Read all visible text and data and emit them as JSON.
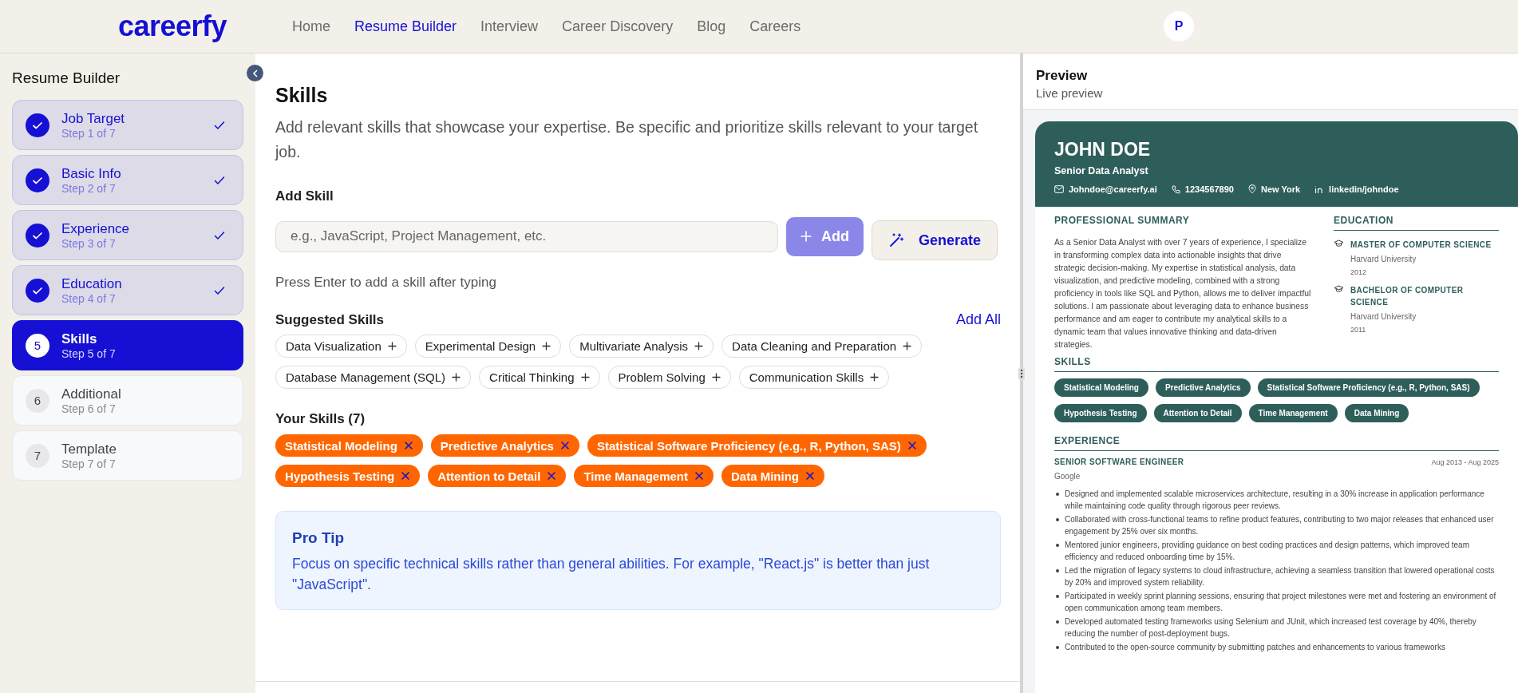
{
  "header": {
    "logo": "careerfy",
    "nav": [
      {
        "label": "Home",
        "selected": false
      },
      {
        "label": "Resume Builder",
        "selected": true
      },
      {
        "label": "Interview",
        "selected": false
      },
      {
        "label": "Career Discovery",
        "selected": false
      },
      {
        "label": "Blog",
        "selected": false
      },
      {
        "label": "Careers",
        "selected": false
      }
    ],
    "avatar": "P"
  },
  "sidebar": {
    "title": "Resume Builder",
    "steps": [
      {
        "label": "Job Target",
        "step": "Step 1 of 7",
        "completed": true,
        "selected": false
      },
      {
        "label": "Basic Info",
        "step": "Step 2 of 7",
        "completed": true,
        "selected": false
      },
      {
        "label": "Experience",
        "step": "Step 3 of 7",
        "completed": true,
        "selected": false
      },
      {
        "label": "Education",
        "step": "Step 4 of 7",
        "completed": true,
        "selected": false
      },
      {
        "number": "5",
        "label": "Skills",
        "step": "Step 5 of 7",
        "completed": false,
        "selected": true
      },
      {
        "number": "6",
        "label": "Additional",
        "step": "Step 6 of 7",
        "completed": false,
        "selected": false
      },
      {
        "number": "7",
        "label": "Template",
        "step": "Step 7 of 7",
        "completed": false,
        "selected": false
      }
    ]
  },
  "editor": {
    "title": "Skills",
    "description": "Add relevant skills that showcase your expertise. Be specific and prioritize skills relevant to your target job.",
    "add_skill": {
      "label": "Add Skill",
      "placeholder": "e.g., JavaScript, Project Management, etc.",
      "add_button": "Add",
      "generate_button": "Generate",
      "hint": "Press Enter to add a skill after typing"
    },
    "suggested": {
      "label": "Suggested Skills",
      "add_all": "Add All",
      "skills": [
        "Data Visualization",
        "Experimental Design",
        "Multivariate Analysis",
        "Data Cleaning and Preparation",
        "Database Management (SQL)",
        "Critical Thinking",
        "Problem Solving",
        "Communication Skills"
      ]
    },
    "your_skills": {
      "label": "Your Skills (7)",
      "skills": [
        "Statistical Modeling",
        "Predictive Analytics",
        "Statistical Software Proficiency (e.g., R, Python, SAS)",
        "Hypothesis Testing",
        "Attention to Detail",
        "Time Management",
        "Data Mining"
      ]
    },
    "tip": {
      "title": "Pro Tip",
      "text": "Focus on specific technical skills rather than general abilities. For example, \"React.js\" is better than just \"JavaScript\"."
    }
  },
  "preview": {
    "title": "Preview",
    "subtitle": "Live preview",
    "resume": {
      "name": "JOHN DOE",
      "role": "Senior Data Analyst",
      "contacts": [
        {
          "kind": "email",
          "text": "Johndoe@careerfy.ai"
        },
        {
          "kind": "phone",
          "text": "1234567890"
        },
        {
          "kind": "location",
          "text": "New York"
        },
        {
          "kind": "linkedin",
          "text": "linkedin/johndoe"
        }
      ],
      "summary_heading": "PROFESSIONAL SUMMARY",
      "summary": "As a Senior Data Analyst with over 7 years of experience, I specialize in transforming complex data into actionable insights that drive strategic decision-making. My expertise in statistical analysis, data visualization, and predictive modeling, combined with a strong proficiency in tools like SQL and Python, allows me to deliver impactful solutions. I am passionate about leveraging data to enhance business performance and am eager to contribute my analytical skills to a dynamic team that values innovative thinking and data-driven strategies.",
      "education_heading": "EDUCATION",
      "education": [
        {
          "degree": "MASTER OF COMPUTER SCIENCE",
          "school": "Harvard University",
          "year": "2012"
        },
        {
          "degree": "BACHELOR OF COMPUTER SCIENCE",
          "school": "Harvard University",
          "year": "2011"
        }
      ],
      "skills_heading": "SKILLS",
      "skills": [
        "Statistical Modeling",
        "Predictive Analytics",
        "Statistical Software Proficiency (e.g., R, Python, SAS)",
        "Hypothesis Testing",
        "Attention to Detail",
        "Time Management",
        "Data Mining"
      ],
      "experience_heading": "EXPERIENCE",
      "jobs": [
        {
          "title": "SENIOR SOFTWARE ENGINEER",
          "dates": "Aug 2013 - Aug 2025",
          "company": "Google",
          "bullets": [
            "Designed and implemented scalable microservices architecture, resulting in a 30% increase in application performance while maintaining code quality through rigorous peer reviews.",
            "Collaborated with cross-functional teams to refine product features, contributing to two major releases that enhanced user engagement by 25% over six months.",
            "Mentored junior engineers, providing guidance on best coding practices and design patterns, which improved team efficiency and reduced onboarding time by 15%.",
            "Led the migration of legacy systems to cloud infrastructure, achieving a seamless transition that lowered operational costs by 20% and improved system reliability.",
            "Participated in weekly sprint planning sessions, ensuring that project milestones were met and fostering an environment of open communication among team members.",
            "Developed automated testing frameworks using Selenium and JUnit, which increased test coverage by 40%, thereby reducing the number of post-deployment bugs.",
            "Contributed to the open-source community by submitting patches and enhancements to various frameworks"
          ]
        }
      ]
    }
  }
}
